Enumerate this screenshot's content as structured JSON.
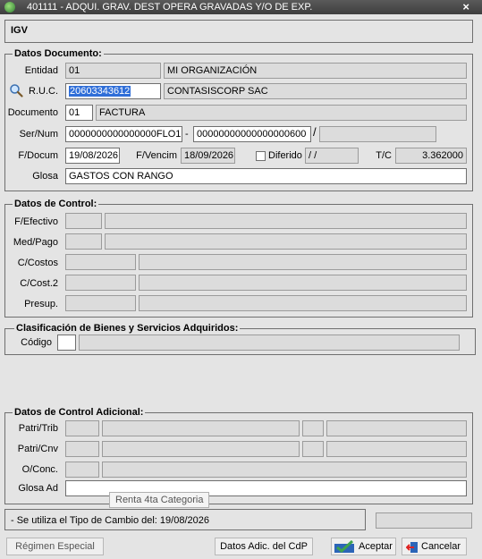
{
  "window": {
    "title": "401111 - ADQUI. GRAV. DEST OPERA GRAVADAS Y/O DE EXP.",
    "close": "×"
  },
  "header": {
    "title": "IGV"
  },
  "datos_documento": {
    "legend": "Datos Documento:",
    "entidad": {
      "label": "Entidad",
      "code": "01",
      "name": "MI ORGANIZACIÓN"
    },
    "ruc": {
      "label": "R.U.C.",
      "value": "20603343612",
      "name": "CONTASISCORP SAC"
    },
    "documento": {
      "label": "Documento",
      "code": "01",
      "name": "FACTURA"
    },
    "sernum": {
      "label": "Ser/Num",
      "serie": "0000000000000000FLO1",
      "sep": "-",
      "numero": "00000000000000000600",
      "slash": "/",
      "extra": ""
    },
    "fdocum": {
      "label": "F/Docum",
      "value": "19/08/2026"
    },
    "fvencim": {
      "label": "F/Vencim",
      "value": "18/09/2026"
    },
    "diferido": {
      "label": "Diferido",
      "value": " /  /"
    },
    "tc": {
      "label": "T/C",
      "value": "3.362000"
    },
    "glosa": {
      "label": "Glosa",
      "value": "GASTOS CON RANGO"
    }
  },
  "datos_control": {
    "legend": "Datos de Control:",
    "fefectivo": "F/Efectivo",
    "medpago": "Med/Pago",
    "ccostos": "C/Costos",
    "ccost2": "C/Cost.2",
    "presup": "Presup."
  },
  "clasificacion": {
    "legend": "Clasificación de Bienes y Servicios Adquiridos:",
    "codigo": "Código"
  },
  "datos_adicional": {
    "legend": "Datos de Control Adicional:",
    "patritrib": "Patri/Trib",
    "patricnv": "Patri/Cnv",
    "oconc": "O/Conc.",
    "glosa_ad": "Glosa Ad"
  },
  "tooltip": "Renta 4ta Categoria",
  "status": {
    "message": "- Se utiliza el Tipo de Cambio del: 19/08/2026"
  },
  "buttons": {
    "regimen": "Régimen Especial",
    "datos_adic": "Datos Adic. del CdP",
    "aceptar": "Aceptar",
    "cancelar": "Cancelar"
  }
}
